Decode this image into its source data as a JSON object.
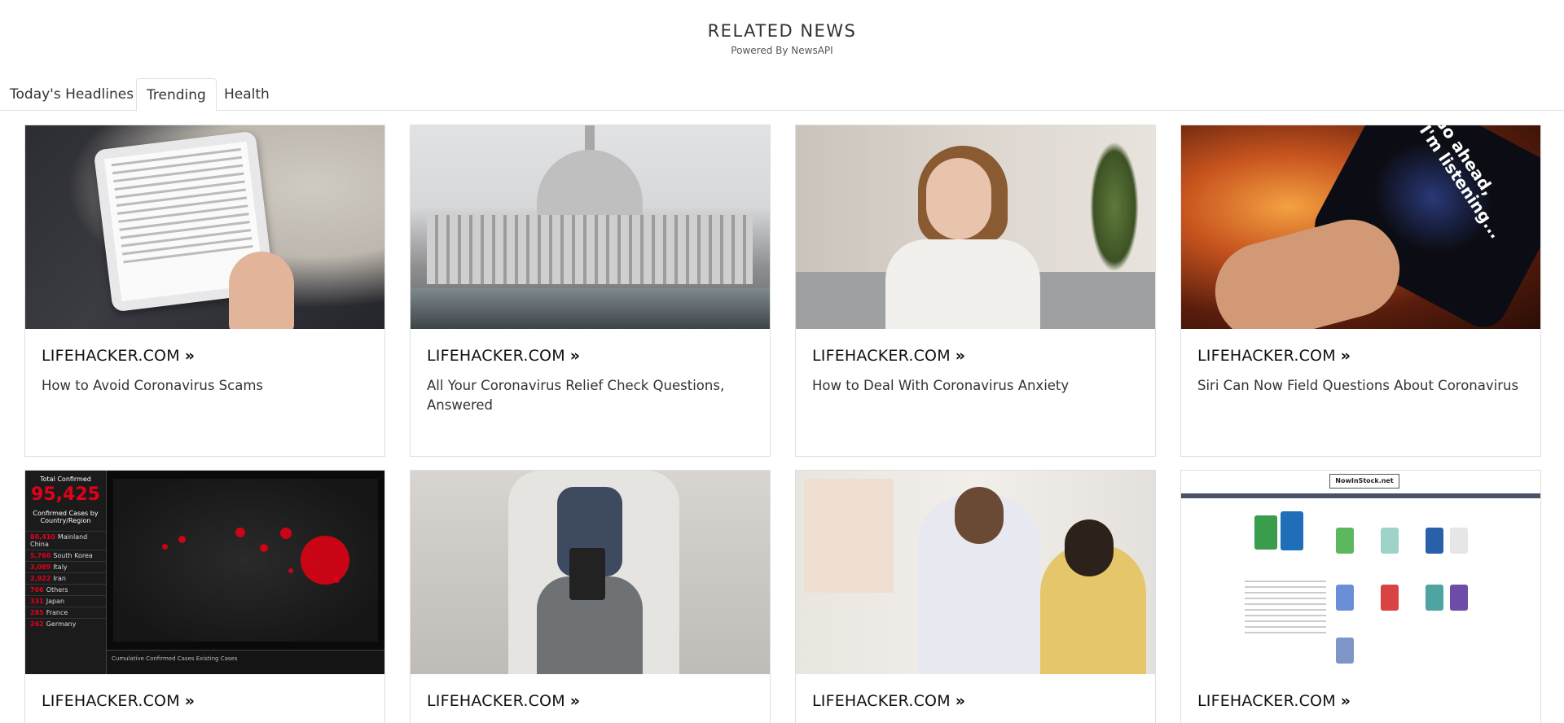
{
  "header": {
    "title": "RELATED NEWS",
    "subtitle": "Powered By NewsAPI"
  },
  "tabs": [
    {
      "label": "Today's Headlines",
      "active": false
    },
    {
      "label": "Trending",
      "active": true
    },
    {
      "label": "Health",
      "active": false
    }
  ],
  "articles": [
    {
      "source": "LIFEHACKER.COM",
      "title": "How to Avoid Coronavirus Scams",
      "image": "tablet-email-image"
    },
    {
      "source": "LIFEHACKER.COM",
      "title": "All Your Coronavirus Relief Check Questions, Answered",
      "image": "capitol-building-image"
    },
    {
      "source": "LIFEHACKER.COM",
      "title": "How to Deal With Coronavirus Anxiety",
      "image": "anxious-woman-image"
    },
    {
      "source": "LIFEHACKER.COM",
      "title": "Siri Can Now Field Questions About Coronavirus",
      "image": "siri-phone-image"
    },
    {
      "source": "LIFEHACKER.COM",
      "title": "",
      "image": "coronavirus-dashboard-image"
    },
    {
      "source": "LIFEHACKER.COM",
      "title": "",
      "image": "ereader-image"
    },
    {
      "source": "LIFEHACKER.COM",
      "title": "",
      "image": "doctor-patient-image"
    },
    {
      "source": "LIFEHACKER.COM",
      "title": "",
      "image": "nowinstock-site-image"
    }
  ],
  "thumb_text": {
    "siri": "Go ahead,\nI'm listening...",
    "dashboard_label": "Total Confirmed",
    "dashboard_total": "95,425",
    "dashboard_list_header": "Confirmed Cases by Country/Region",
    "dashboard_rows": [
      {
        "n": "80,410",
        "c": "Mainland China"
      },
      {
        "n": "5,766",
        "c": "South Korea"
      },
      {
        "n": "3,089",
        "c": "Italy"
      },
      {
        "n": "2,922",
        "c": "Iran"
      },
      {
        "n": "706",
        "c": "Others"
      },
      {
        "n": "331",
        "c": "Japan"
      },
      {
        "n": "285",
        "c": "France"
      },
      {
        "n": "262",
        "c": "Germany"
      }
    ],
    "dashboard_tabs": "Cumulative Confirmed Cases   Existing Cases",
    "stock_logo": "NowInStock.net"
  },
  "chevron_glyph": "»"
}
